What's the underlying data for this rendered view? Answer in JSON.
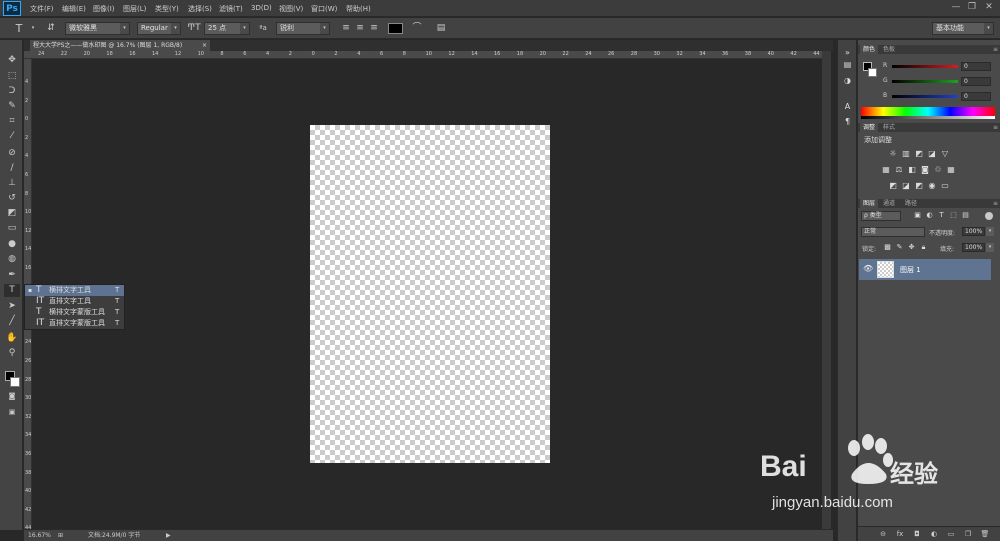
{
  "app": {
    "logo": "Ps"
  },
  "menubar": {
    "items": [
      "文件(F)",
      "编辑(E)",
      "图像(I)",
      "图层(L)",
      "类型(Y)",
      "选择(S)",
      "滤镜(T)",
      "3D(D)",
      "视图(V)",
      "窗口(W)",
      "帮助(H)"
    ],
    "window_controls": [
      "—",
      "❐",
      "✕"
    ]
  },
  "options": {
    "tool_icon": "T",
    "font_family": "微软雅黑",
    "font_style": "Regular",
    "font_size": "25 点",
    "aa_label": "ªa",
    "antialias": "锐利",
    "workspace": "基本功能"
  },
  "document": {
    "tab_title": "程大大学PS之——做水印图 @ 16.7% (图层 1, RGB/8)",
    "tab_close": "×"
  },
  "rulers": {
    "top": [
      "24",
      "22",
      "20",
      "18",
      "16",
      "14",
      "12",
      "10",
      "8",
      "6",
      "4",
      "2",
      "0",
      "2",
      "4",
      "6",
      "8",
      "10",
      "12",
      "14",
      "16",
      "18",
      "20",
      "22",
      "24",
      "26",
      "28",
      "30",
      "32",
      "34",
      "36",
      "38",
      "40",
      "42",
      "44"
    ],
    "left": [
      "4",
      "2",
      "0",
      "2",
      "4",
      "6",
      "8",
      "10",
      "12",
      "14",
      "16",
      "18",
      "20",
      "22",
      "24",
      "26",
      "28",
      "30",
      "32",
      "34",
      "36",
      "38",
      "40",
      "42",
      "44"
    ]
  },
  "type_flyout": [
    {
      "label": "横排文字工具",
      "shortcut": "T",
      "selected": true
    },
    {
      "label": "直排文字工具",
      "shortcut": "T",
      "selected": false
    },
    {
      "label": "横排文字蒙版工具",
      "shortcut": "T",
      "selected": false
    },
    {
      "label": "直排文字蒙版工具",
      "shortcut": "T",
      "selected": false
    }
  ],
  "status": {
    "zoom": "16.67%",
    "doc_info": "文档:24.9M/0 字节"
  },
  "color_panel": {
    "tabs": [
      "颜色",
      "色板"
    ],
    "channels": [
      {
        "label": "R",
        "value": "0",
        "color": "#d22020"
      },
      {
        "label": "G",
        "value": "0",
        "color": "#20a020"
      },
      {
        "label": "B",
        "value": "0",
        "color": "#2040d0"
      }
    ]
  },
  "adjust_panel": {
    "tabs": [
      "调整",
      "样式"
    ],
    "title": "添加调整"
  },
  "layers_panel": {
    "tabs": [
      "图层",
      "通道",
      "路径"
    ],
    "filter_label": "ρ 类型",
    "blend_mode": "正常",
    "opacity_label": "不透明度:",
    "opacity": "100%",
    "lock_label": "锁定:",
    "fill_label": "填充:",
    "fill": "100%",
    "layers": [
      {
        "name": "图层 1"
      }
    ]
  },
  "watermark": {
    "brand": "Bai",
    "brand2": "经验",
    "url": "jingyan.baidu.com"
  }
}
